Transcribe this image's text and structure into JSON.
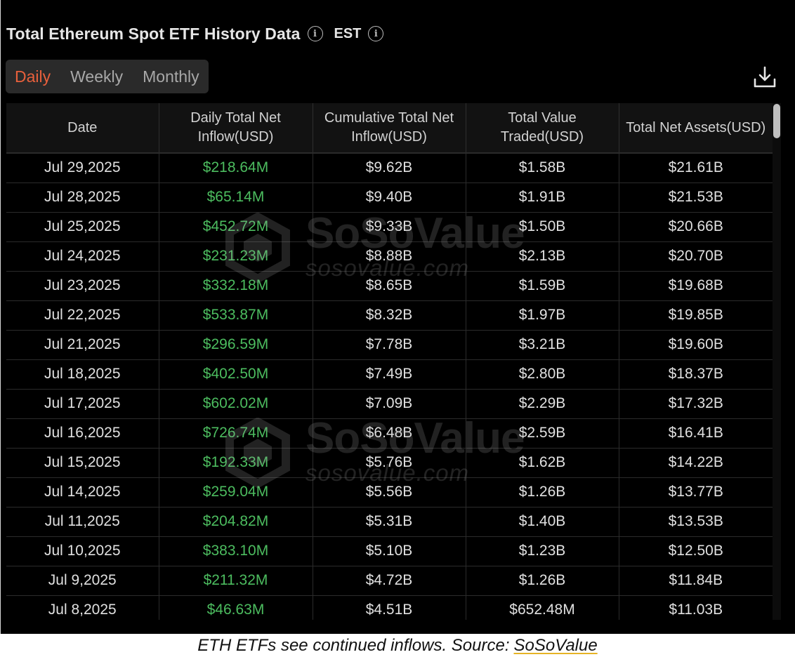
{
  "header": {
    "title": "Total Ethereum Spot ETF History Data",
    "timezone": "EST",
    "icons": [
      "info-icon",
      "info-icon",
      "download-icon"
    ]
  },
  "period_tabs": [
    {
      "label": "Daily",
      "active": true
    },
    {
      "label": "Weekly",
      "active": false
    },
    {
      "label": "Monthly",
      "active": false
    }
  ],
  "table": {
    "columns": [
      "Date",
      "Daily Total Net Inflow(USD)",
      "Cumulative Total Net Inflow(USD)",
      "Total Value Traded(USD)",
      "Total Net Assets(USD)"
    ],
    "rows": [
      [
        "Jul 29,2025",
        "$218.64M",
        "$9.62B",
        "$1.58B",
        "$21.61B"
      ],
      [
        "Jul 28,2025",
        "$65.14M",
        "$9.40B",
        "$1.91B",
        "$21.53B"
      ],
      [
        "Jul 25,2025",
        "$452.72M",
        "$9.33B",
        "$1.50B",
        "$20.66B"
      ],
      [
        "Jul 24,2025",
        "$231.23M",
        "$8.88B",
        "$2.13B",
        "$20.70B"
      ],
      [
        "Jul 23,2025",
        "$332.18M",
        "$8.65B",
        "$1.59B",
        "$19.68B"
      ],
      [
        "Jul 22,2025",
        "$533.87M",
        "$8.32B",
        "$1.97B",
        "$19.85B"
      ],
      [
        "Jul 21,2025",
        "$296.59M",
        "$7.78B",
        "$3.21B",
        "$19.60B"
      ],
      [
        "Jul 18,2025",
        "$402.50M",
        "$7.49B",
        "$2.80B",
        "$18.37B"
      ],
      [
        "Jul 17,2025",
        "$602.02M",
        "$7.09B",
        "$2.29B",
        "$17.32B"
      ],
      [
        "Jul 16,2025",
        "$726.74M",
        "$6.48B",
        "$2.59B",
        "$16.41B"
      ],
      [
        "Jul 15,2025",
        "$192.33M",
        "$5.76B",
        "$1.62B",
        "$14.22B"
      ],
      [
        "Jul 14,2025",
        "$259.04M",
        "$5.56B",
        "$1.26B",
        "$13.77B"
      ],
      [
        "Jul 11,2025",
        "$204.82M",
        "$5.31B",
        "$1.40B",
        "$13.53B"
      ],
      [
        "Jul 10,2025",
        "$383.10M",
        "$5.10B",
        "$1.23B",
        "$12.50B"
      ],
      [
        "Jul 9,2025",
        "$211.32M",
        "$4.72B",
        "$1.26B",
        "$11.84B"
      ],
      [
        "Jul 8,2025",
        "$46.63M",
        "$4.51B",
        "$652.48M",
        "$11.03B"
      ]
    ]
  },
  "watermark": {
    "brand": "SoSoValue",
    "url": "sosovalue.com"
  },
  "caption": {
    "text": "ETH ETFs see continued inflows. Source:",
    "link": "SoSoValue"
  },
  "colors": {
    "background": "#000000",
    "accent": "#e8603c",
    "positive": "#4cbc5f",
    "text": "#e0e0e0"
  }
}
